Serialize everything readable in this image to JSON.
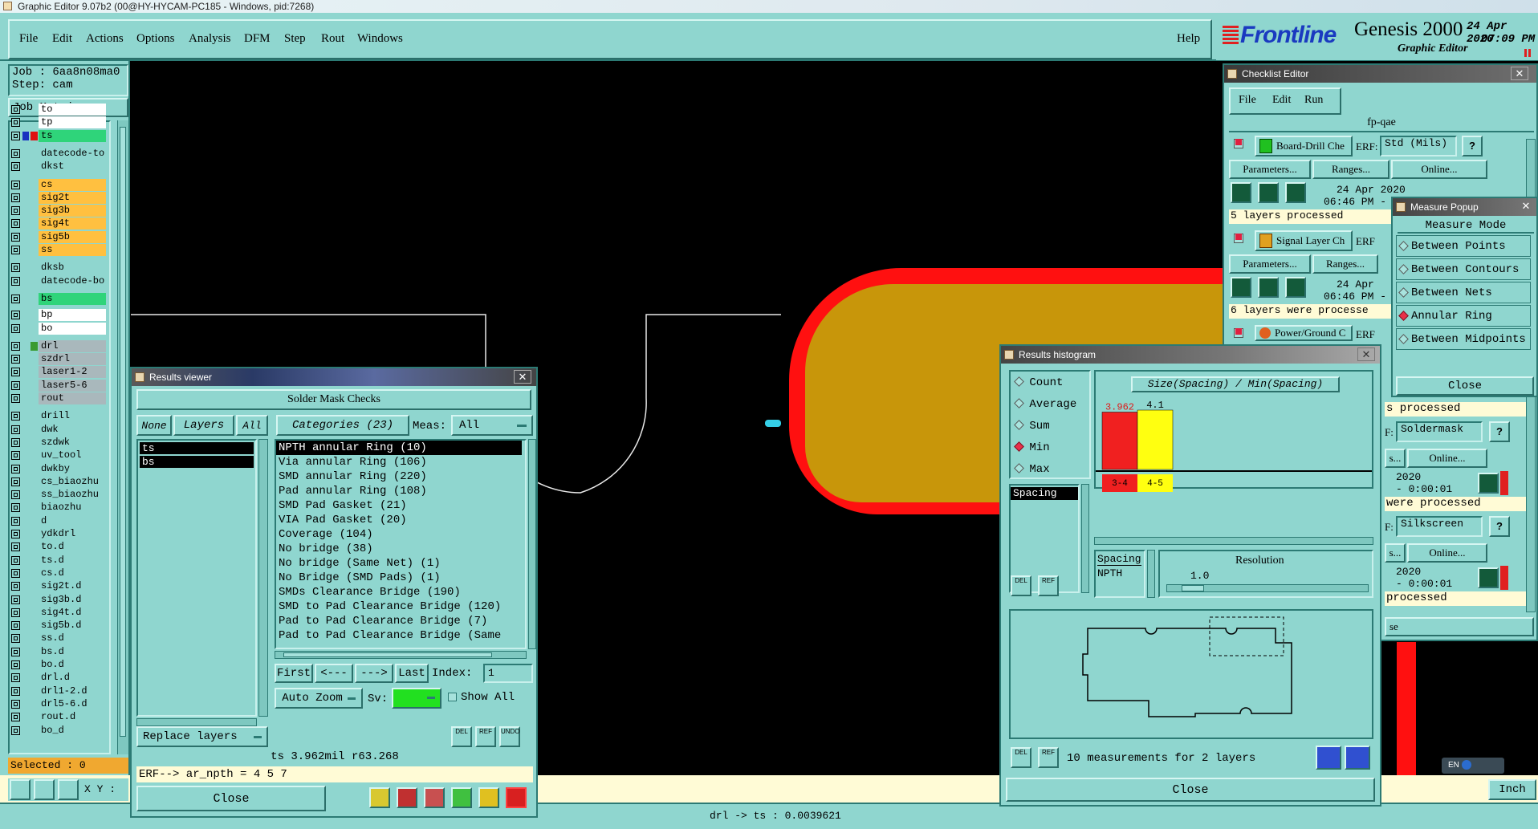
{
  "window": {
    "title": "Graphic Editor 9.07b2 (00@HY-HYCAM-PC185 - Windows, pid:7268)"
  },
  "menubar": {
    "items": [
      "File",
      "Edit",
      "Actions",
      "Options",
      "Analysis",
      "DFM",
      "Step",
      "Rout",
      "Windows"
    ],
    "help": "Help"
  },
  "brand": {
    "logo": "Frontline",
    "product": "Genesis 2000",
    "subtitle": "Graphic Editor",
    "date": "24 Apr 2020",
    "time": "07:09 PM"
  },
  "job": {
    "job": "Job : 6aa8n08ma0",
    "step": "Step: cam",
    "matrix_btn": "Job Matrix ..."
  },
  "layers": [
    {
      "name": "to",
      "color": "#ffffff"
    },
    {
      "name": "tp",
      "color": "#ffffff"
    },
    {
      "name": "ts",
      "color": "#2fd47a"
    },
    {
      "name": "datecode-to",
      "color": "#8fd6cf"
    },
    {
      "name": "dkst",
      "color": "#8fd6cf"
    },
    {
      "name": "cs",
      "color": "#ffc040"
    },
    {
      "name": "sig2t",
      "color": "#ffc040"
    },
    {
      "name": "sig3b",
      "color": "#ffc040"
    },
    {
      "name": "sig4t",
      "color": "#ffc040"
    },
    {
      "name": "sig5b",
      "color": "#ffc040"
    },
    {
      "name": "ss",
      "color": "#ffc040"
    },
    {
      "name": "dksb",
      "color": "#8fd6cf"
    },
    {
      "name": "datecode-bo",
      "color": "#8fd6cf"
    },
    {
      "name": "bs",
      "color": "#2fd47a"
    },
    {
      "name": "bp",
      "color": "#ffffff"
    },
    {
      "name": "bo",
      "color": "#ffffff"
    },
    {
      "name": "drl",
      "color": "#a9b8bc"
    },
    {
      "name": "szdrl",
      "color": "#a9b8bc"
    },
    {
      "name": "laser1-2",
      "color": "#a9b8bc"
    },
    {
      "name": "laser5-6",
      "color": "#a9b8bc"
    },
    {
      "name": "rout",
      "color": "#a9b8bc"
    },
    {
      "name": "drill",
      "color": "#8fd6cf"
    },
    {
      "name": "dwk",
      "color": "#8fd6cf"
    },
    {
      "name": "szdwk",
      "color": "#8fd6cf"
    },
    {
      "name": "uv_tool",
      "color": "#8fd6cf"
    },
    {
      "name": "dwkby",
      "color": "#8fd6cf"
    },
    {
      "name": "cs_biaozhu",
      "color": "#8fd6cf"
    },
    {
      "name": "ss_biaozhu",
      "color": "#8fd6cf"
    },
    {
      "name": "biaozhu",
      "color": "#8fd6cf"
    },
    {
      "name": "d",
      "color": "#8fd6cf"
    },
    {
      "name": "ydkdrl",
      "color": "#8fd6cf"
    },
    {
      "name": "to.d",
      "color": "#8fd6cf"
    },
    {
      "name": "ts.d",
      "color": "#8fd6cf"
    },
    {
      "name": "cs.d",
      "color": "#8fd6cf"
    },
    {
      "name": "sig2t.d",
      "color": "#8fd6cf"
    },
    {
      "name": "sig3b.d",
      "color": "#8fd6cf"
    },
    {
      "name": "sig4t.d",
      "color": "#8fd6cf"
    },
    {
      "name": "sig5b.d",
      "color": "#8fd6cf"
    },
    {
      "name": "ss.d",
      "color": "#8fd6cf"
    },
    {
      "name": "bs.d",
      "color": "#8fd6cf"
    },
    {
      "name": "bo.d",
      "color": "#8fd6cf"
    },
    {
      "name": "drl.d",
      "color": "#8fd6cf"
    },
    {
      "name": "drl1-2.d",
      "color": "#8fd6cf"
    },
    {
      "name": "drl5-6.d",
      "color": "#8fd6cf"
    },
    {
      "name": "rout.d",
      "color": "#8fd6cf"
    },
    {
      "name": "bo_d",
      "color": "#8fd6cf"
    }
  ],
  "selected": "Selected : 0",
  "status": {
    "xy": "X Y :",
    "bottom": "drl -> ts : 0.0039621",
    "units": "Inch"
  },
  "results_viewer": {
    "title": "Results viewer",
    "header": "Solder Mask Checks",
    "none": "None",
    "layers": "Layers",
    "all": "All",
    "layer_items": [
      "ts",
      "bs"
    ],
    "categories_label": "Categories (23)",
    "meas_label": "Meas:",
    "meas_value": "All",
    "categories": [
      "NPTH annular Ring (10)",
      "Via annular Ring (106)",
      "SMD annular Ring (220)",
      "Pad annular Ring (108)",
      "SMD Pad Gasket (21)",
      "VIA Pad Gasket (20)",
      "Coverage (104)",
      "No bridge (38)",
      "No bridge (Same Net) (1)",
      "No Bridge (SMD Pads) (1)",
      "SMDs Clearance Bridge (190)",
      "SMD to Pad Clearance Bridge (120)",
      "Pad to Pad Clearance Bridge (7)",
      "Pad to Pad Clearance Bridge (Same"
    ],
    "first": "First",
    "prev": "<---",
    "next": "--->",
    "last": "Last",
    "index_label": "Index:",
    "index_value": "1",
    "autozoom": "Auto Zoom",
    "sv": "Sv:",
    "show_all": "Show All",
    "replace_layers": "Replace layers",
    "del": "DEL",
    "ref": "REF",
    "undo": "UNDO",
    "info": "ts 3.962mil   r63.268",
    "erf": "ERF--> ar_npth = 4 5 7",
    "close": "Close"
  },
  "checklist": {
    "title": "Checklist Editor",
    "menu": [
      "File",
      "Edit",
      "Run"
    ],
    "name": "fp-qae",
    "rows": [
      {
        "label": "Board-Drill Che",
        "erf": "ERF:",
        "erf_value": "Std (Mils)",
        "date": "24 Apr 2020",
        "time": "06:46 PM -",
        "status": "5 layers processed"
      },
      {
        "label": "Signal Layer Ch",
        "erf": "ERF",
        "date": "24 Apr",
        "time": "06:46 PM -",
        "status": "6 layers were processe"
      },
      {
        "label": "Power/Ground C",
        "erf": "ERF"
      }
    ],
    "params": "Parameters...",
    "ranges": "Ranges...",
    "online": "Online...",
    "right": {
      "status1": "s processed",
      "erf1": "Soldermask",
      "btn1": "s...",
      "online1": "Online...",
      "date1": "2020",
      "time1": "- 0:00:01",
      "status2": "were processed",
      "erf2": "Silkscreen",
      "online2": "Online...",
      "date2": "2020",
      "time2": "- 0:00:01",
      "status3": "processed",
      "close_frag": "se"
    }
  },
  "measure": {
    "title": "Measure Popup",
    "mode": "Measure Mode",
    "items": [
      "Between Points",
      "Between Contours",
      "Between Nets",
      "Annular Ring",
      "Between Midpoints"
    ],
    "selected_index": 3,
    "close": "Close"
  },
  "histogram": {
    "title": "Results histogram",
    "modes": [
      "Count",
      "Average",
      "Sum",
      "Min",
      "Max"
    ],
    "selected_mode": "Min",
    "list_item": "Spacing",
    "chart_title": "Size(Spacing) / Min(Spacing)",
    "spacing_label": "Spacing",
    "npth_label": "NPTH",
    "resolution_label": "Resolution",
    "resolution_value": "1.0",
    "footer": "10 measurements for 2 layers",
    "close": "Close",
    "del": "DEL",
    "ref": "REF"
  },
  "chart_data": {
    "type": "bar",
    "title": "Size(Spacing) / Min(Spacing)",
    "categories": [
      "3-4",
      "4-5"
    ],
    "values": [
      3.962,
      4.1
    ],
    "colors": [
      "#f02020",
      "#ffff10"
    ],
    "value_label_colors": [
      "#e01818",
      "#000000"
    ]
  },
  "tray": {
    "ime": "EN"
  }
}
